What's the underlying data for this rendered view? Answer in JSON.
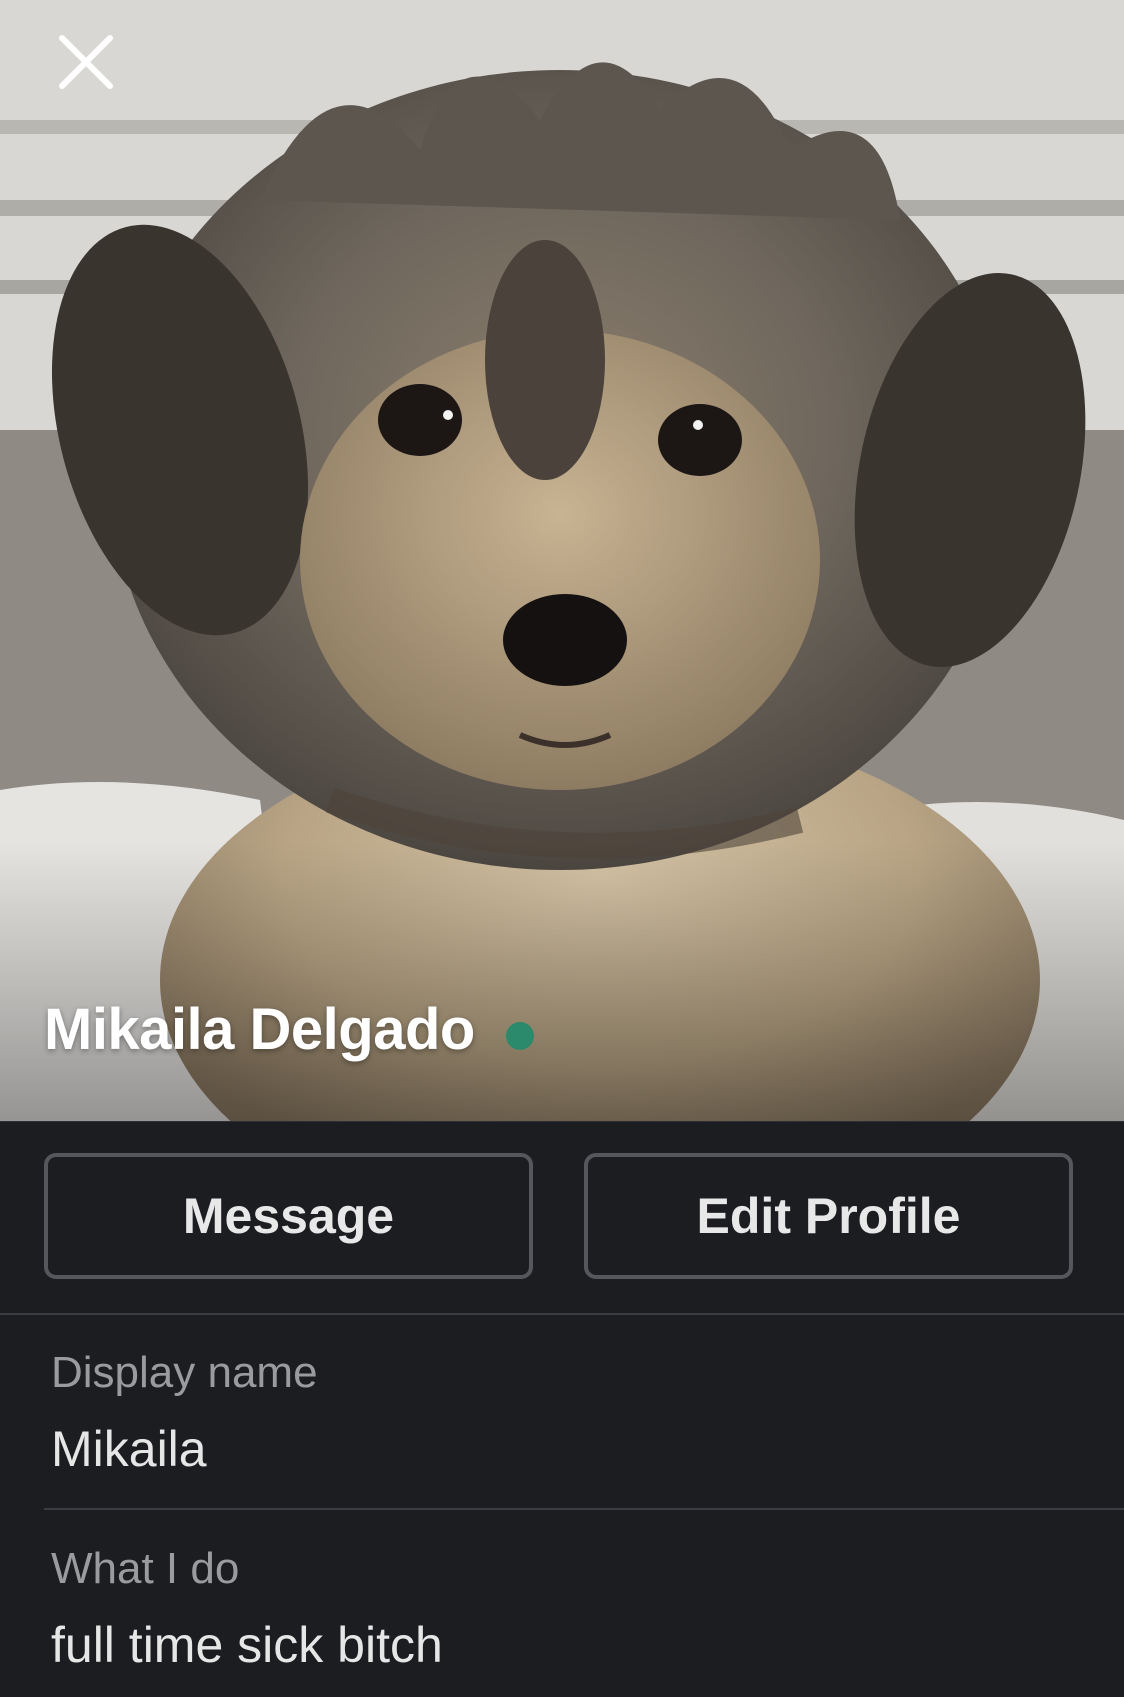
{
  "profile": {
    "name": "Mikaila Delgado",
    "presence_color": "#2b8a6b",
    "photo_subject": "fluffy gray and tan puppy"
  },
  "header": {
    "close_icon": "close-icon"
  },
  "actions": {
    "message_label": "Message",
    "edit_profile_label": "Edit Profile"
  },
  "fields": {
    "display_name": {
      "label": "Display name",
      "value": "Mikaila"
    },
    "what_i_do": {
      "label": "What I do",
      "value": "full time sick bitch"
    }
  }
}
